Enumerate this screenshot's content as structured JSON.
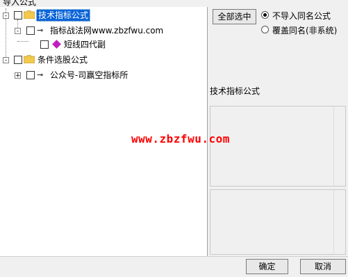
{
  "window": {
    "title": "导入公式"
  },
  "tree": {
    "nodes": [
      {
        "label": "技术指标公式",
        "expander": "-",
        "selected": true
      },
      {
        "label": "指标战法网www.zbzfwu.com",
        "expander": "-"
      },
      {
        "label": "短线四代副"
      },
      {
        "label": "条件选股公式",
        "expander": "-"
      },
      {
        "label": "公众号-司赢空指标所",
        "expander": "+"
      }
    ]
  },
  "buttons": {
    "select_all": "全部选中",
    "ok": "确定",
    "cancel": "取消"
  },
  "options": {
    "no_import_same": "不导入同名公式",
    "overwrite_same": "覆盖同名(非系统)",
    "selected": "no_import_same"
  },
  "info": {
    "formula_name": "技术指标公式"
  },
  "watermark": "www.zbzfwu.com",
  "colors": {
    "selection": "#0a64d8",
    "watermark": "#ff0000",
    "folder": "#f2c94c",
    "formula_icon": "#c020c0"
  }
}
